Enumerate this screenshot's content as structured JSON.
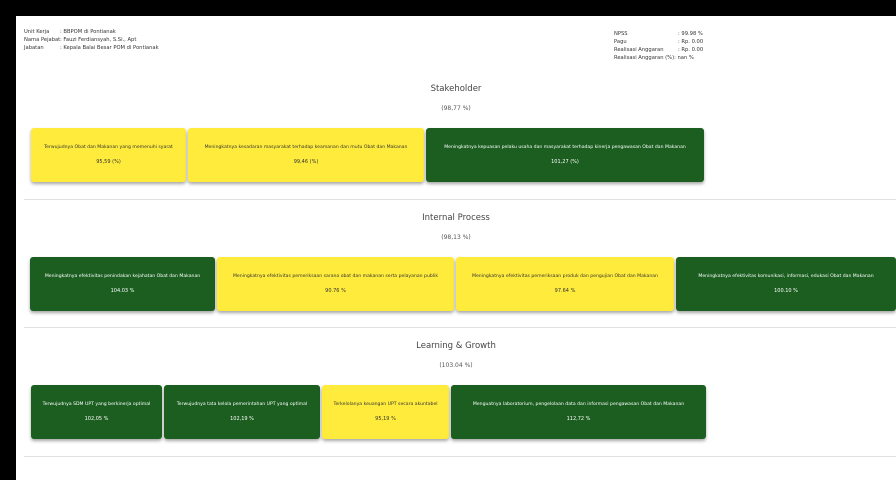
{
  "info_left": [
    {
      "label": "Unit Kerja",
      "value": ": BBPOM di Pontianak"
    },
    {
      "label": "Nama Pejabat",
      "value": ": Fauzi Ferdiansyah, S.Si., Apt"
    },
    {
      "label": "Jabatan",
      "value": ": Kepala Balai Besar POM di Pontianak"
    }
  ],
  "info_right": [
    {
      "label": "NPSS",
      "value": ": 99.98 %"
    },
    {
      "label": "Pagu",
      "value": ": Rp. 0.00"
    },
    {
      "label": "Realisasi Anggaran",
      "value": ": Rp. 0.00"
    },
    {
      "label": "Realisasi Anggaran (%)",
      "value": ": nan %"
    }
  ],
  "colors": {
    "green": "#1b5e20",
    "yellow": "#ffeb3b"
  },
  "sections": [
    {
      "title": "Stakeholder",
      "pct": "(98,77 %)",
      "cards": [
        {
          "text": "Terwujudnya Obat dan Makanan yang memenuhi syarat",
          "value": "95,59 (%)",
          "color": "yellow"
        },
        {
          "text": "Meningkatnya kesadaran masyarakat terhadap keamanan dan mutu Obat dan Makanan",
          "value": "99,46 (%)",
          "color": "yellow"
        },
        {
          "text": "Meningkatnya kepuasan pelaku usaha dan masyarakat terhadap kinerja pengawasan Obat dan Makanan",
          "value": "101,27 (%)",
          "color": "green"
        }
      ]
    },
    {
      "title": "Internal Process",
      "pct": "(98,13 %)",
      "cards": [
        {
          "text": "Meningkatnya efektivitas penindakan kejahatan Obat dan Makanan",
          "value": "104.03 %",
          "color": "green"
        },
        {
          "text": "Meningkatnya efektivitas pemeriksaan sarana obat dan makanan serta pelayanan publik",
          "value": "90.76 %",
          "color": "yellow"
        },
        {
          "text": "Meningkatnya efektivitas pemeriksaan produk dan pengujian Obat dan Makanan",
          "value": "97.64 %",
          "color": "yellow"
        },
        {
          "text": "Meningkatnya efektivitas komunikasi, informasi, edukasi Obat dan Makanan",
          "value": "100.10 %",
          "color": "green"
        }
      ]
    },
    {
      "title": "Learning & Growth",
      "pct": "(103.04 %)",
      "cards": [
        {
          "text": "Terwujudnya SDM UPT yang berkinerja optimal",
          "value": "102,05 %",
          "color": "green"
        },
        {
          "text": "Terwujudnya tata kelola pemerintahan UPT yang optimal",
          "value": "102,19 %",
          "color": "green"
        },
        {
          "text": "Terkelolanya keuangan UPT secara akuntabel",
          "value": "95,19 %",
          "color": "yellow"
        },
        {
          "text": "Menguatnya laboratorium, pengelolaan data dan informasi pengawasan Obat dan Makanan",
          "value": "112,72 %",
          "color": "green"
        }
      ]
    }
  ]
}
